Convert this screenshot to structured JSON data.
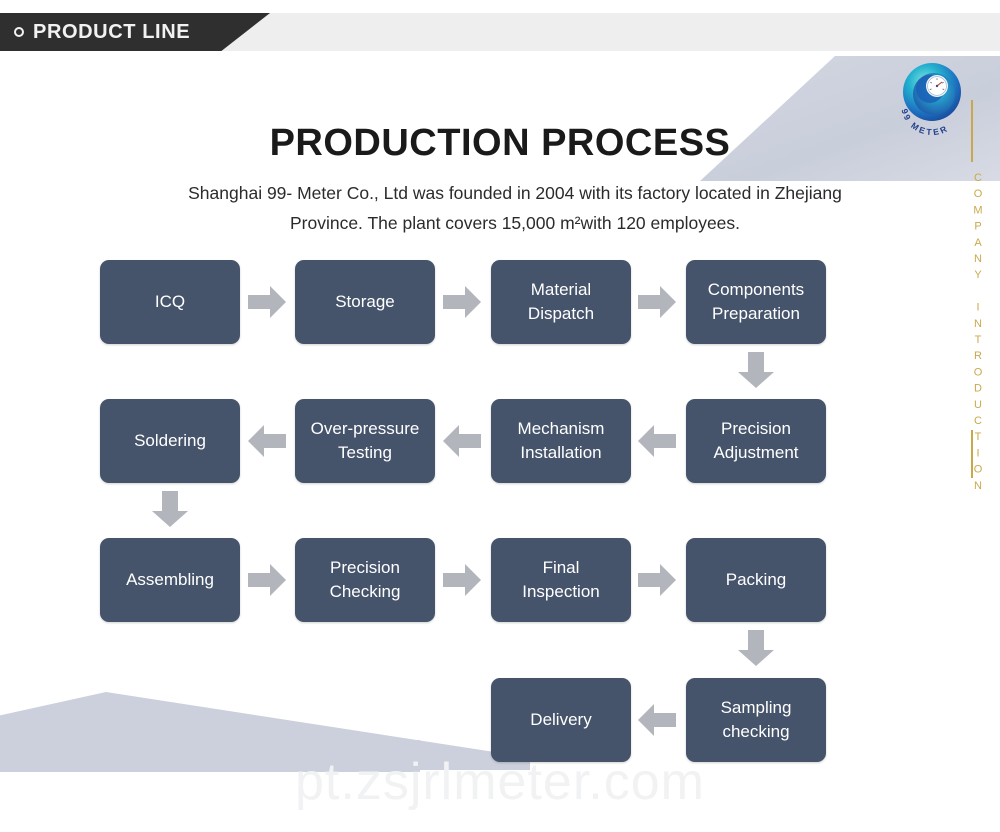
{
  "banner": {
    "label": "PRODUCT LINE",
    "bullet_icon": "circle-outline-icon",
    "dark_color": "#2f2f2f",
    "light_color": "#eeeeee"
  },
  "side": {
    "vertical_text": "COMPANY INTRODUCTION",
    "rule_color": "#c9a84c"
  },
  "logo": {
    "brand_text": "99 METER",
    "icon": "spiral-gauge-logo-icon",
    "color_outer": "#1aa9c4",
    "color_inner": "#1e4fa0"
  },
  "header": {
    "title": "PRODUCTION PROCESS",
    "subtitle": "Shanghai 99- Meter Co., Ltd was founded in 2004 with its factory located in Zhejiang Province. The plant covers 15,000 m²with 120 employees."
  },
  "flow": {
    "box_color": "#45536b",
    "arrow_color": "#b2b5bc",
    "rows": [
      {
        "direction": "right",
        "boxes": [
          "ICQ",
          "Storage",
          "Material Dispatch",
          "Components Preparation"
        ]
      },
      {
        "direction": "left",
        "boxes": [
          "Soldering",
          "Over-pressure Testing",
          "Mechanism Installation",
          "Precision Adjustment"
        ]
      },
      {
        "direction": "right",
        "boxes": [
          "Assembling",
          "Precision Checking",
          "Final Inspection",
          "Packing"
        ]
      },
      {
        "direction": "left",
        "boxes": [
          "Delivery",
          "Sampling checking"
        ]
      }
    ],
    "steps": {
      "s1": "ICQ",
      "s2": "Storage",
      "s3_l1": "Material",
      "s3_l2": "Dispatch",
      "s4_l1": "Components",
      "s4_l2": "Preparation",
      "s5_l1": "Precision",
      "s5_l2": "Adjustment",
      "s6_l1": "Mechanism",
      "s6_l2": "Installation",
      "s7_l1": "Over-pressure",
      "s7_l2": "Testing",
      "s8": "Soldering",
      "s9": "Assembling",
      "s10_l1": "Precision",
      "s10_l2": "Checking",
      "s11_l1": "Final",
      "s11_l2": "Inspection",
      "s12": "Packing",
      "s13_l1": "Sampling",
      "s13_l2": "checking",
      "s14": "Delivery"
    }
  },
  "watermark": {
    "text": "pt.zsjrlmeter.com"
  }
}
